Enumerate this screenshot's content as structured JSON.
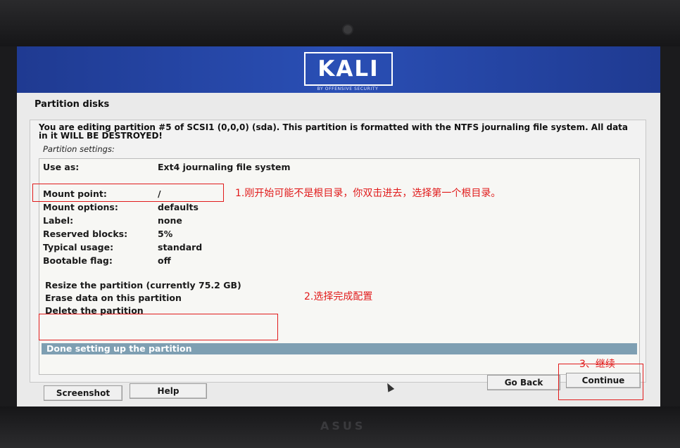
{
  "installer": {
    "brand": "KALI",
    "brand_sub": "BY OFFENSIVE SECURITY",
    "step_title": "Partition disks",
    "description": "You are editing partition #5 of SCSI1 (0,0,0) (sda). This partition is formatted with the NTFS journaling file system. All data in it WILL BE DESTROYED!",
    "settings_label": "Partition settings:",
    "settings": [
      {
        "key": "Use as:",
        "value": "Ext4 journaling file system"
      },
      {
        "key": "Mount point:",
        "value": "/"
      },
      {
        "key": "Mount options:",
        "value": "defaults"
      },
      {
        "key": "Label:",
        "value": "none"
      },
      {
        "key": "Reserved blocks:",
        "value": "5%"
      },
      {
        "key": "Typical usage:",
        "value": "standard"
      },
      {
        "key": "Bootable flag:",
        "value": "off"
      }
    ],
    "actions": [
      "Resize the partition (currently 75.2 GB)",
      "Erase data on this partition",
      "Delete the partition",
      "Done setting up the partition"
    ],
    "buttons": {
      "screenshot": "Screenshot",
      "help": "Help",
      "go_back": "Go Back",
      "continue": "Continue"
    }
  },
  "annotations": {
    "note1": "1.刚开始可能不是根目录，你双击进去，选择第一个根目录。",
    "note2": "2.选择完成配置",
    "note3": "3、继续"
  },
  "bezel": {
    "logo": "ASUS"
  },
  "colors": {
    "banner": "#2a4fb5",
    "selection": "#7e9fb2",
    "annotation": "#e11b1b"
  }
}
